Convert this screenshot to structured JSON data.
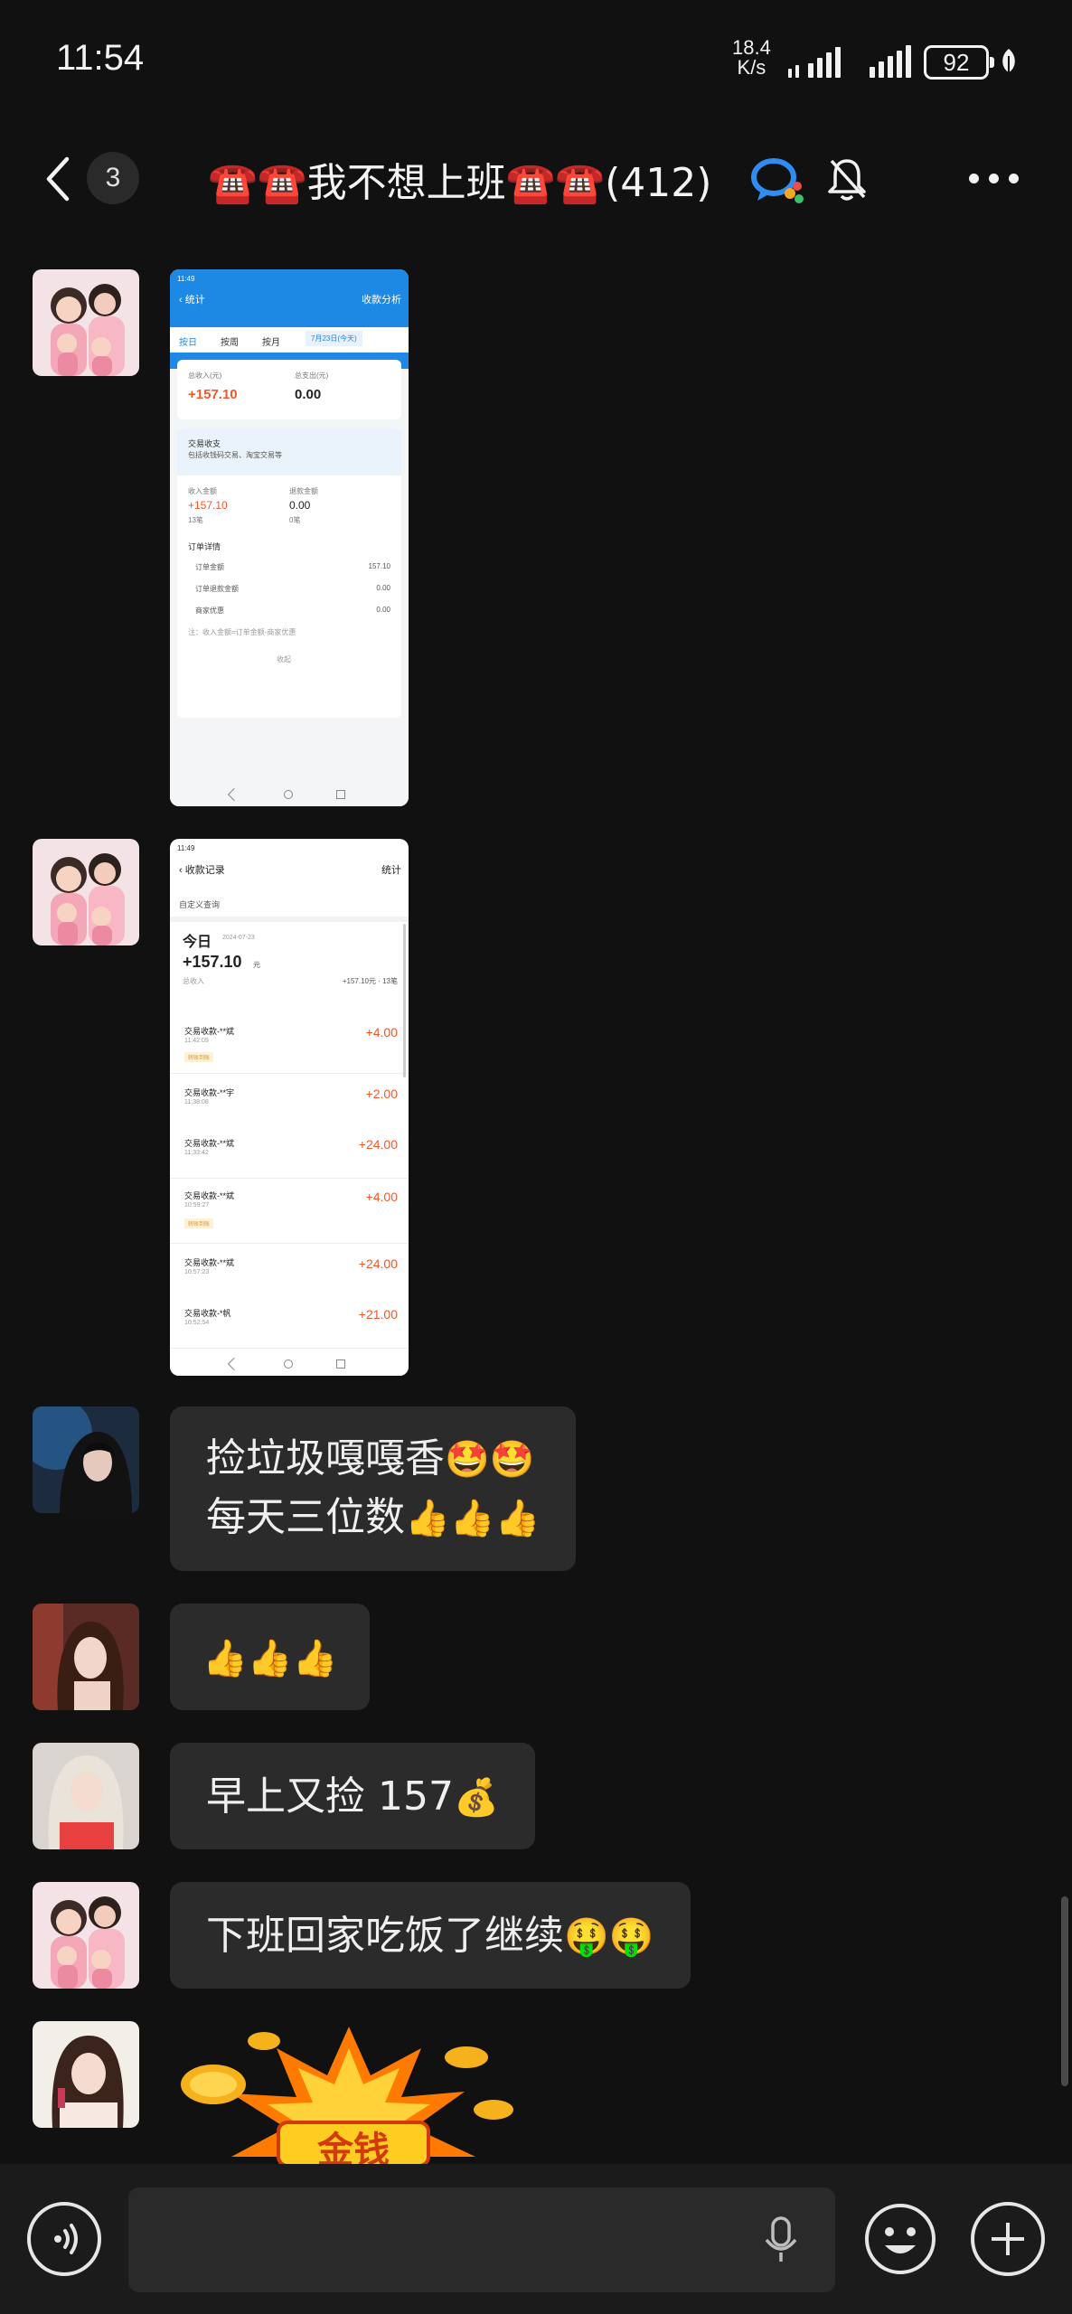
{
  "status_bar": {
    "time": "11:54",
    "net_speed_value": "18.4",
    "net_speed_unit": "K/s",
    "battery": "92"
  },
  "header": {
    "unread_count": "3",
    "title": "☎️☎️我不想上班☎️☎️(412)"
  },
  "shot1": {
    "time": "11:49",
    "nav_title": "统计",
    "nav_right": "收款分析",
    "tabs": [
      "按日",
      "按周",
      "按月"
    ],
    "date_chip": "7月23日(今天)",
    "total_income_label": "总收入(元)",
    "total_income": "+157.10",
    "total_expense_label": "总支出(元)",
    "total_expense": "0.00",
    "trade_title": "交易收支",
    "trade_desc": "包括收钱码交易、淘宝交易等",
    "income_label": "收入金额",
    "income_value": "+157.10",
    "income_count": "13笔",
    "refund_label": "退款金额",
    "refund_value": "0.00",
    "refund_count": "0笔",
    "order_title": "订单详情",
    "order_rows": [
      {
        "label": "订单金额",
        "value": "157.10"
      },
      {
        "label": "订单退款金额",
        "value": "0.00"
      },
      {
        "label": "商家优惠",
        "value": "0.00"
      }
    ],
    "formula": "注：收入金额=订单金额-商家优惠",
    "collapse": "收起"
  },
  "shot2": {
    "time": "11:49",
    "nav_title": "收款记录",
    "nav_right": "统计",
    "query": "自定义查询",
    "day": "今日",
    "date": "2024-07-23",
    "total": "+157.10",
    "total_unit": "元",
    "total_label": "总收入",
    "summary": "+157.10元 · 13笔",
    "records": [
      {
        "title": "交易收款-**斌",
        "time": "11:42:09",
        "amount": "+4.00",
        "tag": "转账到账"
      },
      {
        "title": "交易收款-**宇",
        "time": "11:38:08",
        "amount": "+2.00",
        "tag": ""
      },
      {
        "title": "交易收款-**斌",
        "time": "11:33:42",
        "amount": "+24.00",
        "tag": ""
      },
      {
        "title": "交易收款-**斌",
        "time": "10:59:27",
        "amount": "+4.00",
        "tag": "转账到账"
      },
      {
        "title": "交易收款-**斌",
        "time": "10:57:23",
        "amount": "+24.00",
        "tag": ""
      },
      {
        "title": "交易收款-*帆",
        "time": "10:52:54",
        "amount": "+21.00",
        "tag": ""
      }
    ]
  },
  "messages": {
    "m3_line1": "捡垃圾嘎嘎香",
    "m3_line1_emoji": "🤩🤩",
    "m3_line2": "每天三位数",
    "m3_line2_emoji": "👍👍👍",
    "m4_emoji": "👍👍👍",
    "m5_text": "早上又捡 157",
    "m5_emoji": "💰",
    "m6_text": "下班回家吃饭了继续",
    "m6_emoji": "🤑🤑",
    "sticker_text": "金钱"
  },
  "colors": {
    "background": "#111111",
    "bubble": "#2b2b2b",
    "alipay_blue": "#1e88e5",
    "amount_orange": "#f0582c"
  }
}
